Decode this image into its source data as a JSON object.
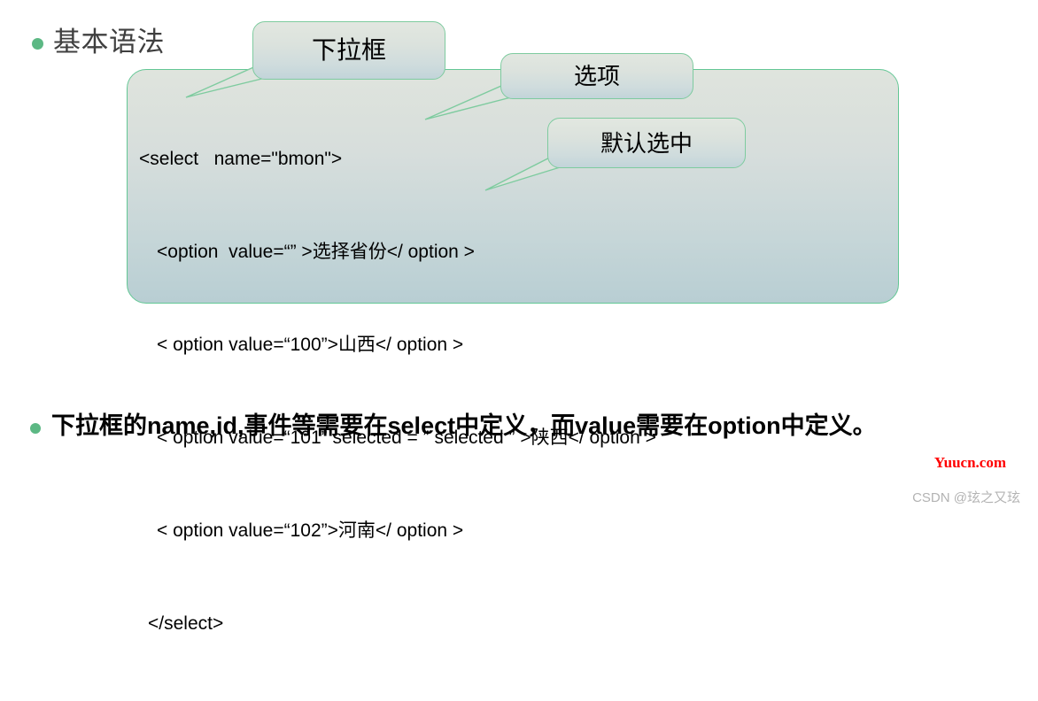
{
  "slide": {
    "heading": {
      "bullet_icon": "bullet-dot-icon",
      "text": "基本语法"
    },
    "code_panel": {
      "lines": [
        "<select   name=\"bmon\">",
        "<option  value=“” >选择省份</ option >",
        "< option value=“100”>山西</ option >",
        "< option value=“101” selected = ” selected ” >陕西</ option >",
        "< option value=“102”>河南</ option >",
        "</select>"
      ]
    },
    "callouts": [
      {
        "id": "dropdown",
        "label": "下拉框"
      },
      {
        "id": "option",
        "label": "选项"
      },
      {
        "id": "selected",
        "label": "默认选中"
      }
    ],
    "summary": {
      "bullet_icon": "bullet-dot-icon",
      "text": "下拉框的name,id,事件等需要在select中定义，而value需要在option中定义。"
    },
    "watermarks": {
      "site": "Yuucn.com",
      "author": "CSDN @玹之又玹"
    },
    "colors": {
      "bullet_green": "#5cb884",
      "panel_border": "#63c795",
      "callout_border": "#7ecb9f",
      "heading_text": "#3f3f3f",
      "watermark_red": "#ff0000",
      "watermark_gray": "#b3b3b3"
    }
  }
}
